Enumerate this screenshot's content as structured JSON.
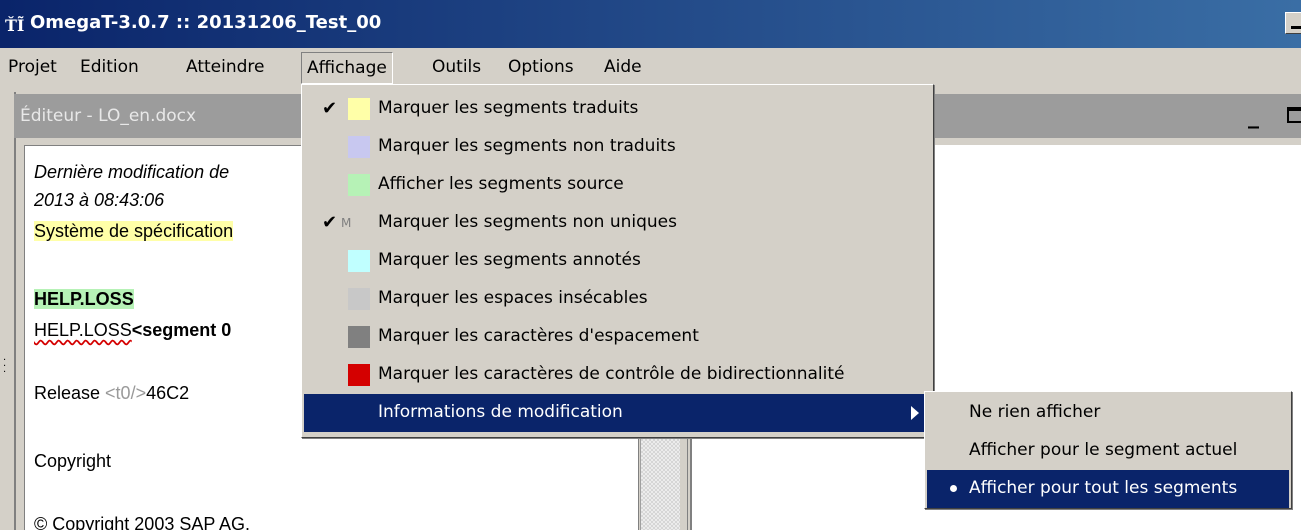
{
  "window": {
    "title": "OmegaT-3.0.7 :: 20131206_Test_00"
  },
  "menubar": {
    "items": [
      "Projet",
      "Edition",
      "Atteindre",
      "Affichage",
      "Outils",
      "Options",
      "Aide"
    ],
    "active": "Affichage"
  },
  "editor": {
    "title": "Éditeur - LO_en.docx",
    "lines": {
      "l1": "Dernière modification de",
      "l2": "2013 à 08:43:06",
      "l3": "Système de spécification",
      "l4": "HELP.LOSS",
      "l5a": "HELP.LOSS",
      "l5b": "<segment 0",
      "l6a": "Release ",
      "l6tag": "<t0/>",
      "l6b": "46C2",
      "l7": "Copyright",
      "l8": "© Copyright 2003 SAP AG."
    }
  },
  "affichage_menu": {
    "items": [
      {
        "label": "Marquer les segments traduits",
        "checked": true,
        "swatch": "#ffffa8"
      },
      {
        "label": "Marquer les segments non traduits",
        "checked": false,
        "swatch": "#c8c8f0"
      },
      {
        "label": "Afficher les segments source",
        "checked": false,
        "swatch": "#b6f2b6"
      },
      {
        "label": "Marquer les segments non uniques",
        "checked": true,
        "swatch": null,
        "marker": "M"
      },
      {
        "label": "Marquer les segments annotés",
        "checked": false,
        "swatch": "#c0ffff"
      },
      {
        "label": "Marquer les espaces insécables",
        "checked": false,
        "swatch": "#c8c8c8"
      },
      {
        "label": "Marquer les caractères d'espacement",
        "checked": false,
        "swatch": "#808080"
      },
      {
        "label": "Marquer les caractères de contrôle de bidirectionnalité",
        "checked": false,
        "swatch": "#d40000"
      },
      {
        "label": "Informations de modification",
        "checked": false,
        "swatch": null,
        "submenu": true
      }
    ]
  },
  "submenu": {
    "items": [
      {
        "label": "Ne rien afficher",
        "selected": false
      },
      {
        "label": "Afficher pour le segment actuel",
        "selected": false
      },
      {
        "label": "Afficher pour tout les segments",
        "selected": true
      }
    ]
  }
}
